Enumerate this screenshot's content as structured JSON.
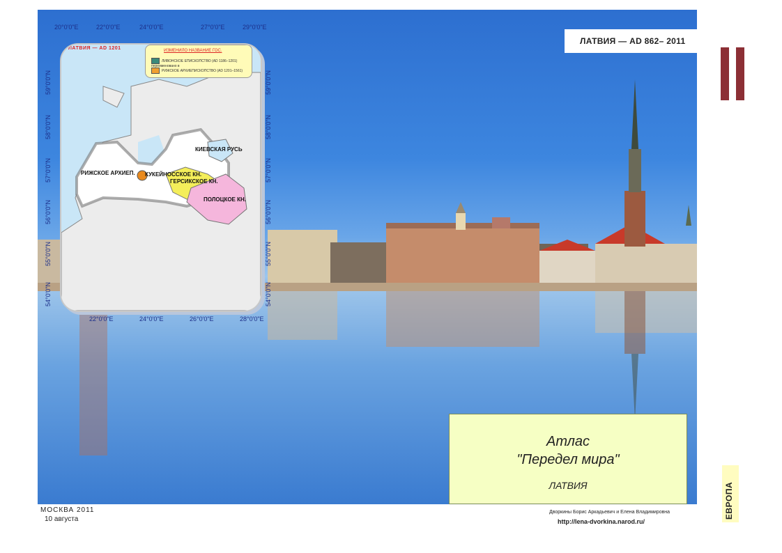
{
  "header": {
    "title": "ЛАТВИЯ — AD 862– 2011"
  },
  "map": {
    "title": "ЛАТВИЯ — AD 1201",
    "top_coords": [
      "20°0'0\"E",
      "22°0'0\"E",
      "24°0'0\"E",
      "27°0'0\"E",
      "29°0'0\"E"
    ],
    "bottom_coords": [
      "22°0'0\"E",
      "24°0'0\"E",
      "26°0'0\"E",
      "28°0'0\"E"
    ],
    "left_coords": [
      "59°0'0\"N",
      "58°0'0\"N",
      "57°0'0\"N",
      "56°0'0\"N",
      "55°0'0\"N",
      "54°0'0\"N"
    ],
    "right_coords": [
      "59°0'0\"N",
      "58°0'0\"N",
      "57°0'0\"N",
      "56°0'0\"N",
      "55°0'0\"N",
      "54°0'0\"N"
    ],
    "legend": {
      "heading": "ИЗМЕНИЛО НАЗВАНИЕ ГОС.",
      "items": [
        {
          "text": "ЛИВОНСКОЕ ЕПИСКОПСТВО (AD 1186–1201) переименовано в",
          "color": "#3a8a7a"
        },
        {
          "text": "РИЖСКОЕ АРХИЕПИСКОПСТВО (AD 1201–1561)",
          "color": "#f0a030"
        }
      ]
    },
    "regions": {
      "kiev": "КИЕВСКАЯ РУСЬ",
      "riga": "РИЖСКОЕ АРХИЕП.",
      "kukeinos": "КУКЕЙНОССКОЕ  КН.",
      "gersik": "ГЕРСИКСКОЕ КН.",
      "polotsk": "ПОЛОЦКОЕ КН."
    },
    "colors": {
      "sea": "#c9e6f7",
      "land": "#ececec",
      "latvia": "#ffffff",
      "kukeinos": "#f4ee5a",
      "polotsk": "#f5b6dc",
      "riga_dot": "#e98a1e"
    }
  },
  "atlas": {
    "line1": "Атлас",
    "line2": "\"Передел мира\"",
    "line3": "ЛАТВИЯ"
  },
  "side_label": "ЕВРОПА",
  "footer": {
    "city_year": "МОСКВА   2011",
    "date": "10 августа",
    "authors": "Дворкины Борис Аркадьевич и Елена Владимировна",
    "url": "http://lena-dvorkina.narod.ru/"
  },
  "colors": {
    "accent": "#8c2f35",
    "atlas_bg": "#f6ffc4",
    "europa_bg": "#fffcc0"
  }
}
